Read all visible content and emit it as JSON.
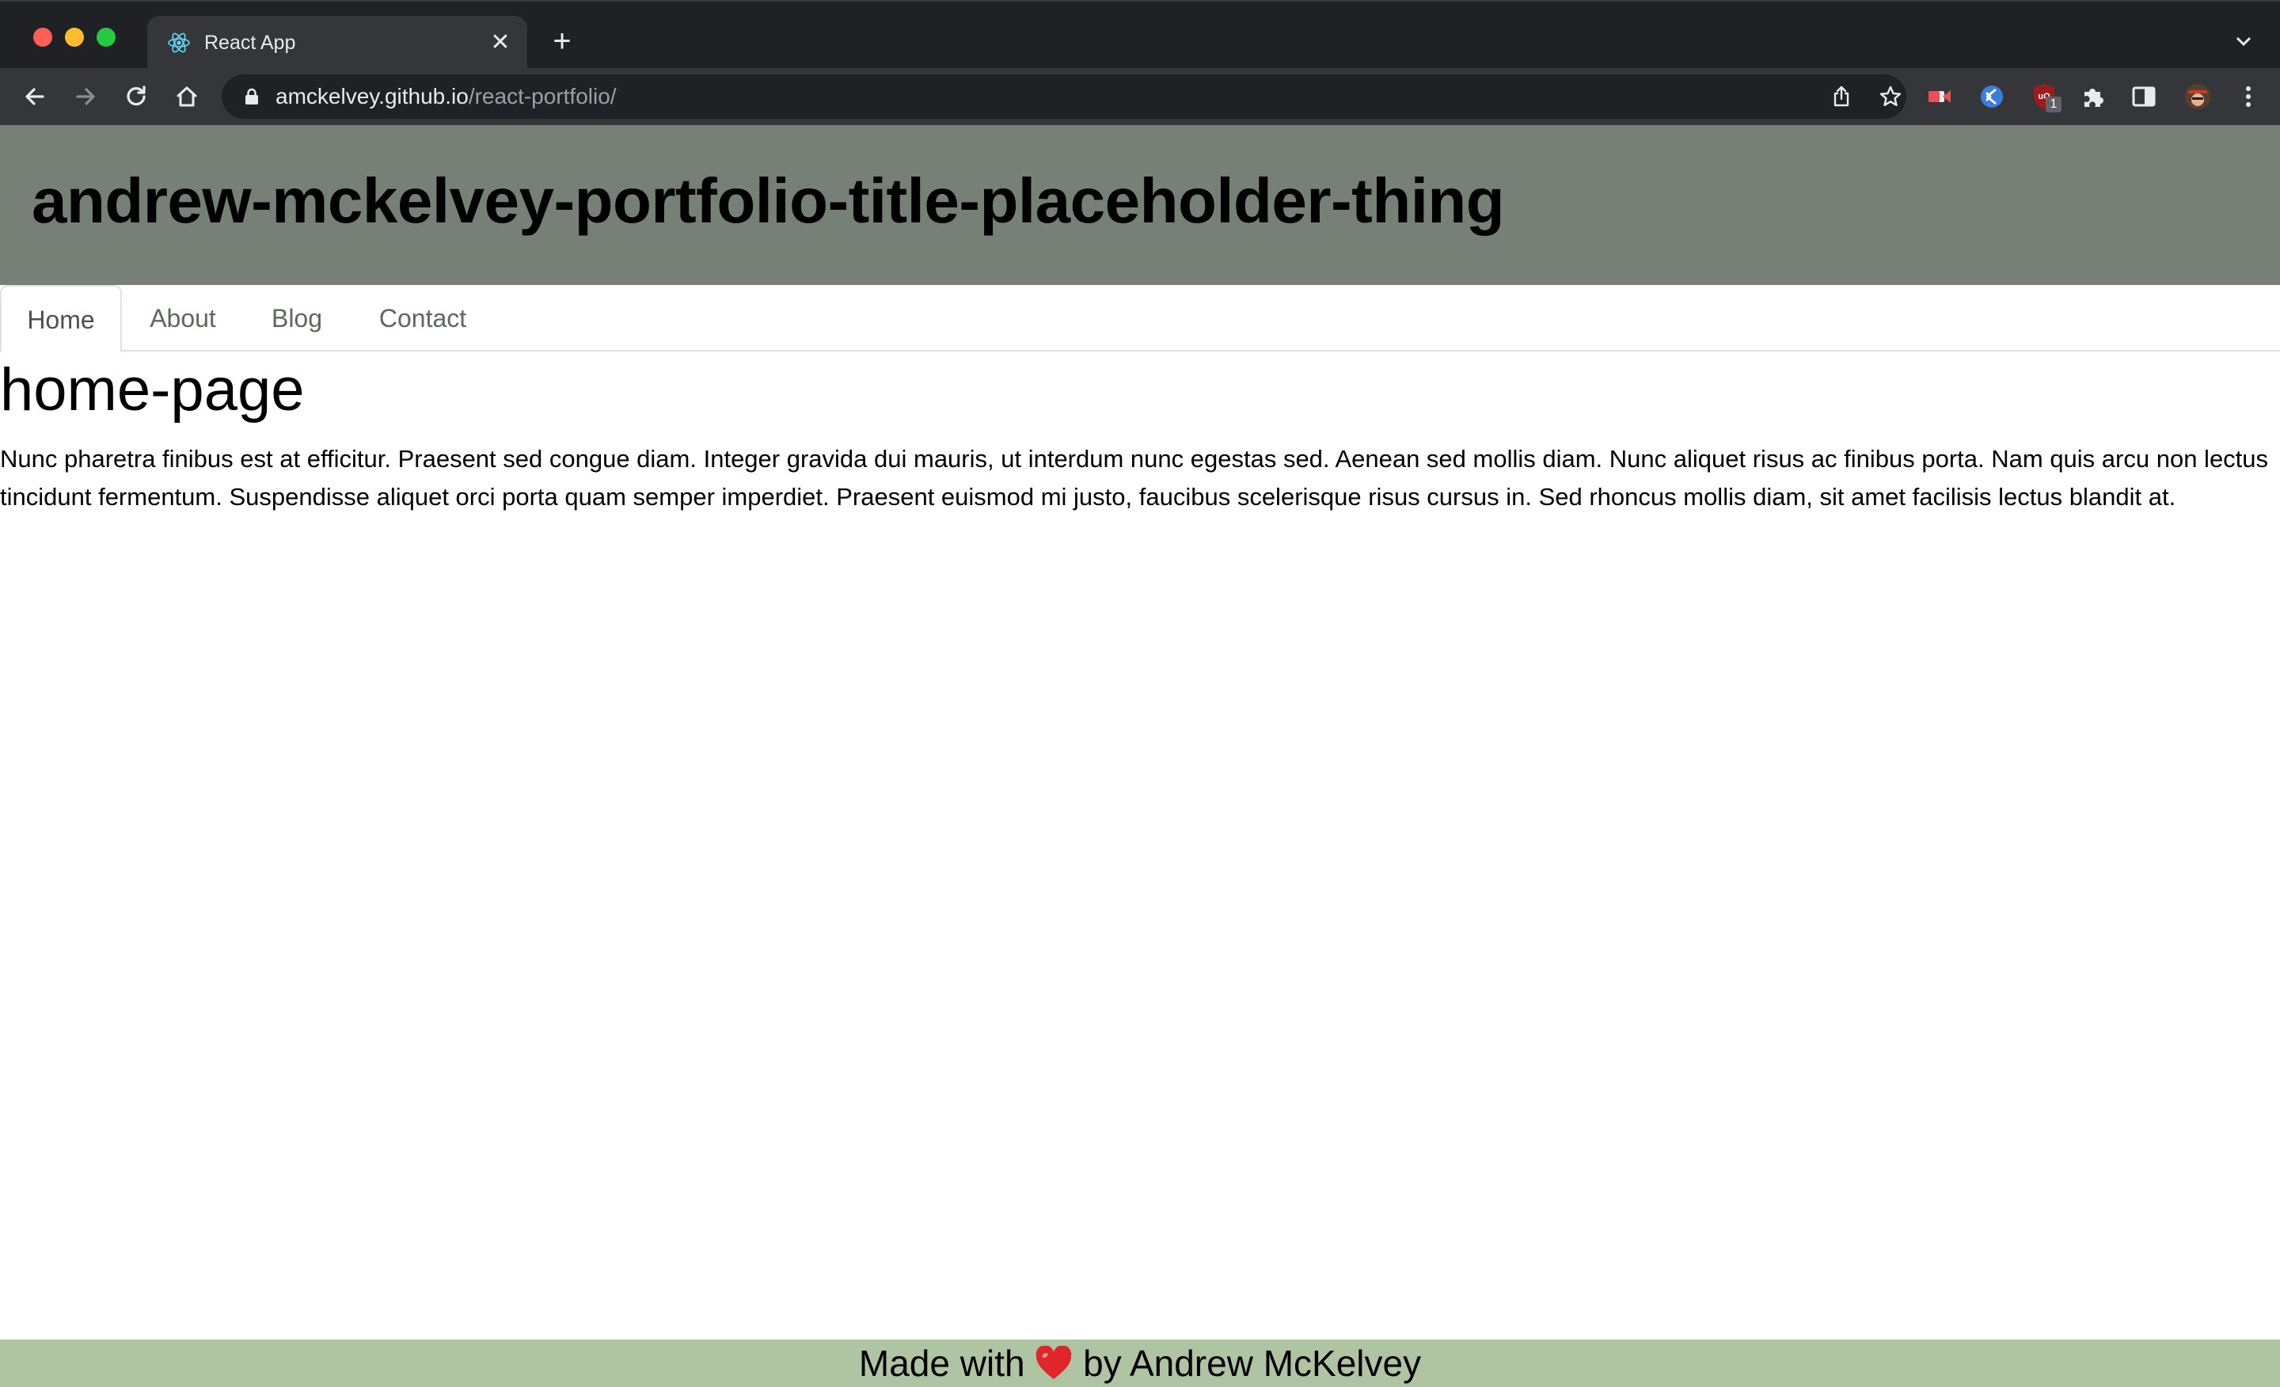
{
  "browser": {
    "tab": {
      "title": "React App",
      "favicon": "react-icon"
    },
    "omnibox": {
      "host": "amckelvey.github.io",
      "path": "/react-portfolio/"
    },
    "extensions": [
      "screencast-icon",
      "vscode-icon",
      "ublock-icon",
      "puzzle-icon"
    ],
    "extension_badge": "1",
    "colors": {
      "tabstrip": "#202124",
      "toolbar": "#35363a",
      "omnibox": "#202124"
    }
  },
  "site": {
    "title": "andrew-mckelvey-portfolio-title-placeholder-thing",
    "nav": [
      {
        "label": "Home",
        "active": true
      },
      {
        "label": "About",
        "active": false
      },
      {
        "label": "Blog",
        "active": false
      },
      {
        "label": "Contact",
        "active": false
      }
    ],
    "page_heading": "home-page",
    "body": "Nunc pharetra finibus est at efficitur. Praesent sed congue diam. Integer gravida dui mauris, ut interdum nunc egestas sed. Aenean sed mollis diam. Nunc aliquet risus ac finibus porta. Nam quis arcu non lectus tincidunt fermentum. Suspendisse aliquet orci porta quam semper imperdiet. Praesent euismod mi justo, faucibus scelerisque risus cursus in. Sed rhoncus mollis diam, sit amet facilisis lectus blandit at.",
    "footer": {
      "before": "Made with ",
      "icon": "heart-icon",
      "after": " by Andrew McKelvey"
    },
    "colors": {
      "header": "#778077",
      "footer": "#aec4a2",
      "nav_text": "#5b6a5b"
    }
  }
}
